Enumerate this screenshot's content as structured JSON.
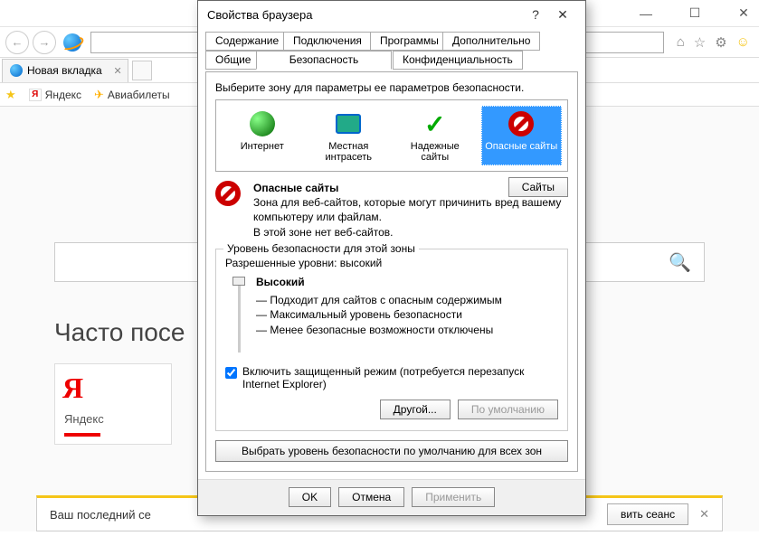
{
  "window": {
    "tab_title": "Новая вкладка"
  },
  "bookmarks": {
    "yandex": "Яндекс",
    "avia": "Авиабилеты"
  },
  "page": {
    "frequent_heading": "Часто посе",
    "tile_yandex": "Яндекс",
    "notif_text": "Ваш последний се",
    "notif_restore": "вить сеанс"
  },
  "dialog": {
    "title": "Свойства браузера",
    "tabs": {
      "content": "Содержание",
      "connections": "Подключения",
      "programs": "Программы",
      "advanced": "Дополнительно",
      "general": "Общие",
      "security": "Безопасность",
      "privacy": "Конфиденциальность"
    },
    "zone_prompt": "Выберите зону для параметры ее параметров безопасности.",
    "zones": {
      "internet": "Интернет",
      "intranet": "Местная интрасеть",
      "trusted": "Надежные сайты",
      "restricted": "Опасные сайты"
    },
    "zone_name": "Опасные сайты",
    "zone_desc_1": "Зона для веб-сайтов, которые могут причинить вред вашему компьютеру или файлам.",
    "zone_desc_2": "В этой зоне нет веб-сайтов.",
    "sites_btn": "Сайты",
    "sec_group_title": "Уровень безопасности для этой зоны",
    "allowed_levels": "Разрешенные уровни: высокий",
    "level_name": "Высокий",
    "level_b1": "— Подходит для сайтов с опасным содержимым",
    "level_b2": "— Максимальный уровень безопасности",
    "level_b3": "— Менее безопасные возможности отключены",
    "protected_mode": "Включить защищенный режим (потребуется перезапуск Internet Explorer)",
    "custom_btn": "Другой...",
    "default_btn": "По умолчанию",
    "reset_all": "Выбрать уровень безопасности по умолчанию для всех зон",
    "ok": "OK",
    "cancel": "Отмена",
    "apply": "Применить"
  }
}
